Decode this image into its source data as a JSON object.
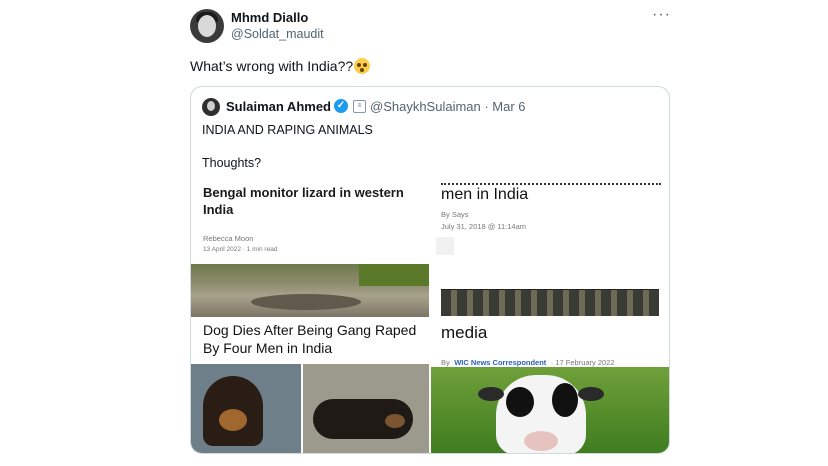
{
  "tweet": {
    "author_name": "Mhmd Diallo",
    "author_handle": "@Soldat_maudit",
    "more_label": "···",
    "text": "What’s wrong with India??",
    "emoji_icon": "flushed-face-emoji"
  },
  "quoted": {
    "author_name": "Sulaiman Ahmed",
    "verified_icon": "verified-badge-icon",
    "handle_and_date": "@ShaykhSulaiman · Mar 6",
    "line1": "INDIA AND RAPING ANIMALS",
    "line2": "Thoughts?",
    "articles": [
      {
        "headline": "Bengal monitor lizard in western India",
        "byline": "Rebecca Moon",
        "date": "13 April 2022 · 1 min read"
      },
      {
        "headline": "men in India",
        "byline": "By Says",
        "date": "July 31, 2018 @ 11:14am"
      },
      {
        "headline": "Dog Dies After Being Gang Raped By Four Men in India"
      },
      {
        "headline": "media",
        "byline_prefix": "By",
        "byline": "WIC News Correspondent",
        "date": "· 17 February 2022"
      }
    ]
  },
  "colors": {
    "accent_blue": "#1d9bf0",
    "muted_text": "#536471",
    "border": "#cfd9de"
  }
}
